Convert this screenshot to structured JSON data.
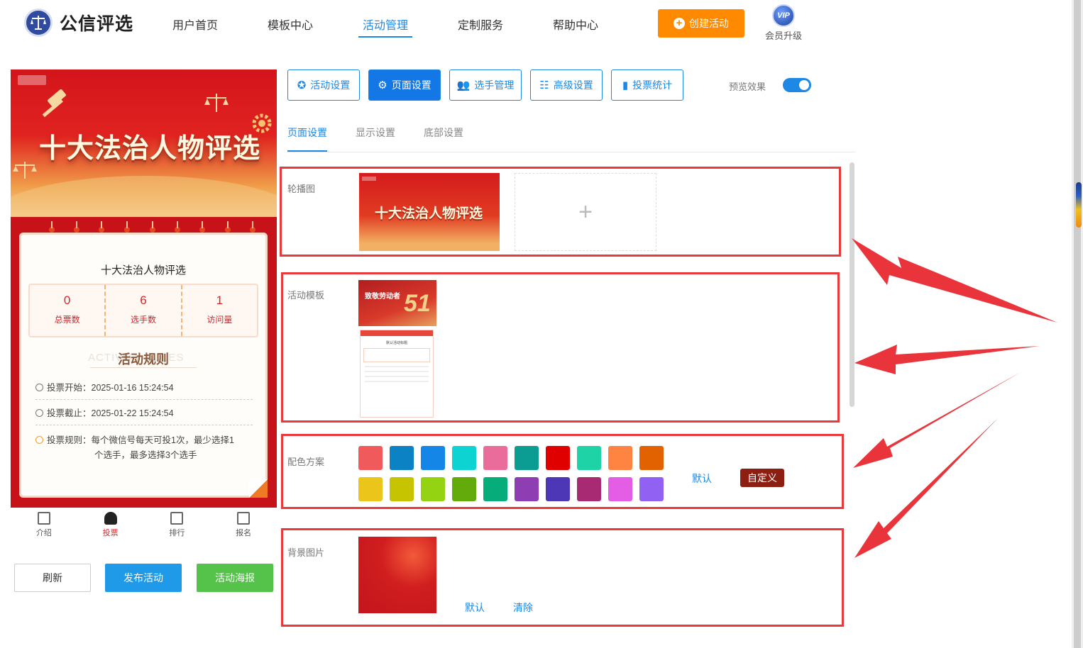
{
  "header": {
    "logo_text": "公信评选",
    "nav": [
      "用户首页",
      "模板中心",
      "活动管理",
      "定制服务",
      "帮助中心"
    ],
    "active_nav": "活动管理",
    "create_button": "创建活动",
    "vip_badge": "VIP",
    "vip_label": "会员升级"
  },
  "preview": {
    "banner_title": "十大法治人物评选",
    "card_title": "十大法治人物评选",
    "stats": [
      {
        "value": "0",
        "label": "总票数"
      },
      {
        "value": "6",
        "label": "选手数"
      },
      {
        "value": "1",
        "label": "访问量"
      }
    ],
    "rules_bg": "ACTIVITY RULES",
    "rules_title": "活动规则",
    "rules": {
      "start": "投票开始：2025-01-16 15:24:54",
      "end": "投票截止：2025-01-22 15:24:54",
      "rule_line1": "投票规则：每个微信号每天可投1次，最少选择1",
      "rule_line2": "个选手，最多选择3个选手"
    },
    "tabbar": [
      "介绍",
      "投票",
      "排行",
      "报名"
    ],
    "active_tab": "投票"
  },
  "actions": {
    "refresh": "刷新",
    "publish": "发布活动",
    "poster": "活动海报"
  },
  "toolbar": {
    "buttons": [
      "活动设置",
      "页面设置",
      "选手管理",
      "高级设置",
      "投票统计"
    ],
    "active": "页面设置",
    "preview_label": "预览效果",
    "preview_on": true
  },
  "subtabs": [
    "页面设置",
    "显示设置",
    "底部设置"
  ],
  "settings": {
    "carousel_label": "轮播图",
    "carousel_image_text": "十大法治人物评选",
    "upload_icon": "+",
    "template_label": "活动模板",
    "template_image_title": "致敬劳动者",
    "template_image_number": "51",
    "template_preview_title": "默认活动标题",
    "color_label": "配色方案",
    "colors_row1": [
      "#f15a5a",
      "#0a82c4",
      "#1486e8",
      "#0dd3d3",
      "#ea6c9a",
      "#0b9c94",
      "#e00000",
      "#1ed3a6",
      "#ff8442",
      "#e26100"
    ],
    "colors_row2": [
      "#ebc51a",
      "#c6c400",
      "#93d312",
      "#62ab0a",
      "#06ad7a",
      "#8f3db2",
      "#4d37b7",
      "#a82a73",
      "#e45de5",
      "#9061f2"
    ],
    "color_default": "默认",
    "color_custom": "自定义",
    "bg_label": "背景图片",
    "bg_default": "默认",
    "bg_clear": "清除"
  }
}
